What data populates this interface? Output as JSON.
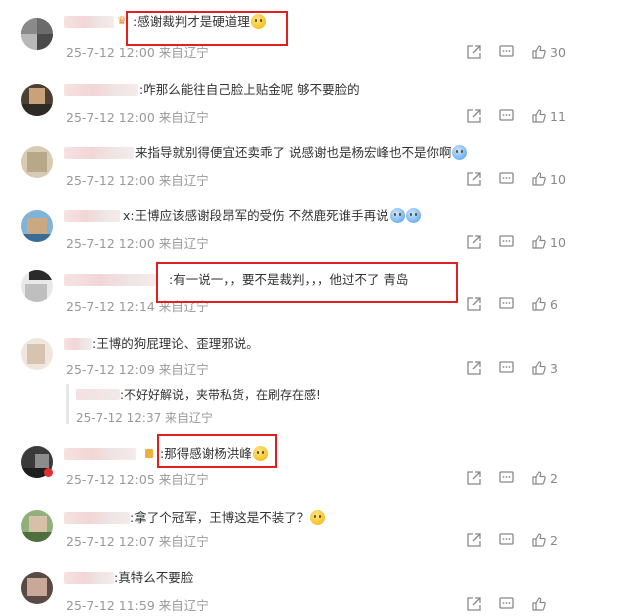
{
  "comments": [
    {
      "text": ":感谢裁判才是硬道理",
      "emoji": "smile",
      "meta": "25-7-12 12:00 来自辽宁",
      "likes": "30",
      "name_w": 50,
      "badge": "crown"
    },
    {
      "text": ":咋那么能往自己脸上贴金呢 够不要脸的",
      "meta": "25-7-12 12:00 来自辽宁",
      "likes": "11",
      "name_w": 74
    },
    {
      "text": "来指导就别得便宜还卖乖了 说感谢也是杨宏峰也不是你啊",
      "emoji": "blue",
      "meta": "25-7-12 12:00 来自辽宁",
      "likes": "10",
      "name_w": 70
    },
    {
      "text": "x:王博应该感谢段昂军的受伤 不然鹿死谁手再说",
      "emoji": "pair",
      "meta": "25-7-12 12:00 来自辽宁",
      "likes": "10",
      "name_w": 56
    },
    {
      "text": ":有一说一，，要不是裁判，，，他过不了 青岛",
      "meta": "25-7-12 12:14 来自辽宁",
      "likes": "6",
      "name_w": 92
    },
    {
      "text": ":王博的狗屁理论、歪理邪说。",
      "meta": "25-7-12 12:09 来自辽宁",
      "likes": "3",
      "name_w": 28
    },
    {
      "text": ":那得感谢杨洪峰",
      "emoji": "smile",
      "meta": "25-7-12 12:05 来自辽宁",
      "likes": "2",
      "name_w": 72,
      "badge": "lock"
    },
    {
      "text": ":拿了个冠军，王博这是不装了？",
      "emoji": "smile",
      "meta": "25-7-12 12:07 来自辽宁",
      "likes": "2",
      "name_w": 66
    },
    {
      "text": ":真特么不要脸",
      "meta": "25-7-12 11:59 来自辽宁",
      "likes": "",
      "name_w": 50
    }
  ],
  "reply": {
    "text": ":不好好解说，夹带私货，在刷存在感!",
    "meta": "25-7-12 12:37 来自辽宁"
  },
  "icons": {
    "share": "share-icon",
    "comment": "comment-icon",
    "like": "thumbs-up-icon"
  }
}
